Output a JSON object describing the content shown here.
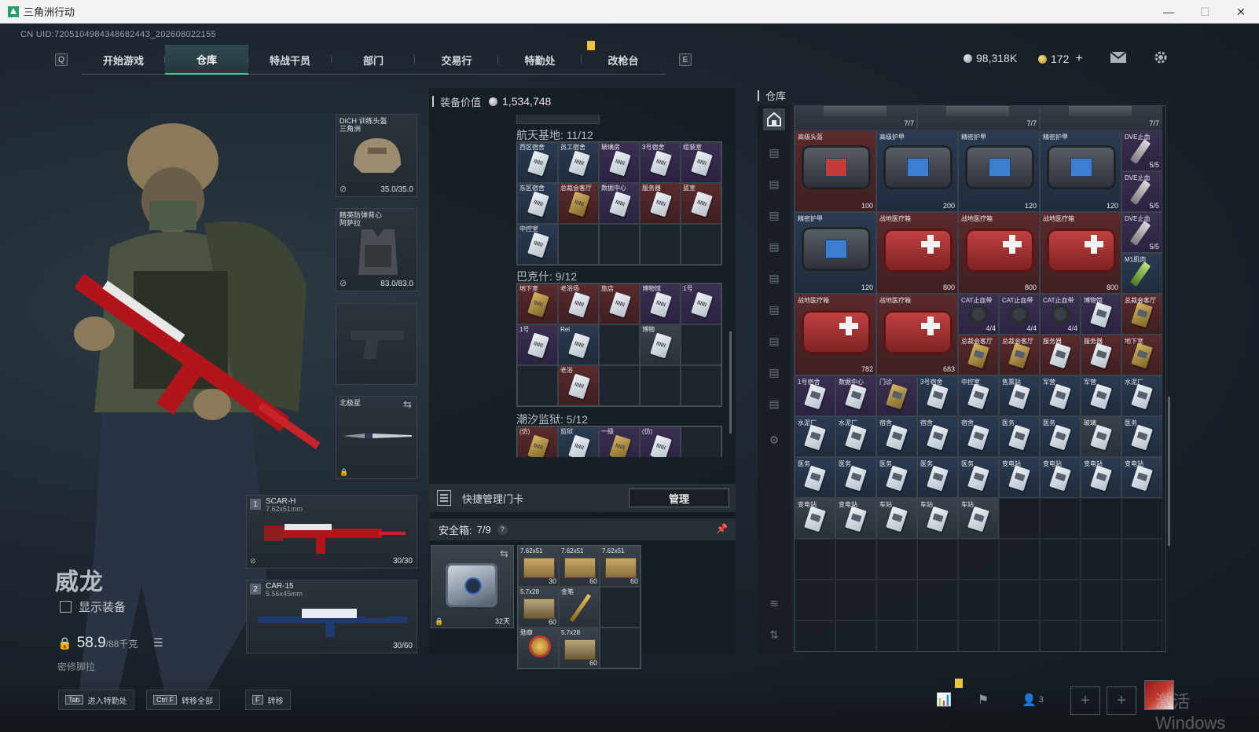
{
  "window": {
    "title": "三角洲行动",
    "minimize": "—",
    "maximize": "☐",
    "close": "✕"
  },
  "uid": "CN UID:720510498434868244З_202608022155",
  "nav": {
    "left_key": "Q",
    "right_key": "E",
    "tabs": [
      "开始游戏",
      "仓库",
      "特战干员",
      "部门",
      "交易行",
      "特勤处",
      "改枪台"
    ],
    "active_tab": "仓库"
  },
  "currency": {
    "silver": "98,318K",
    "gold": "172",
    "gold_add": "+"
  },
  "operator": {
    "name": "威龙",
    "show_gear_label": "显示装备",
    "weight_value": "58.9",
    "weight_max": "/88千克",
    "map": "密修脚拉"
  },
  "gear": {
    "helmet": {
      "label": "DICH 训练头盔\n三角洲",
      "durability": "35.0/35.0"
    },
    "armor": {
      "label": "精英防弹背心\n阿萨拉",
      "durability": "83.0/83.0"
    },
    "melee": {
      "label": "北极星"
    },
    "primary": {
      "slot": "1",
      "name": "SCAR-H",
      "caliber": "7.62x51mm",
      "ammo": "30/30"
    },
    "secondary": {
      "slot": "2",
      "name": "CAR-15",
      "caliber": "5.56x45mm",
      "ammo": "30/60"
    }
  },
  "mid": {
    "equip_value_label": "装备价值",
    "equip_value": "1,534,748",
    "sections": [
      {
        "title": "航天基地: 11/12",
        "cells": [
          {
            "label": "西区宿舍",
            "color": "blue",
            "card": "silver"
          },
          {
            "label": "员工宿舍",
            "color": "blue",
            "card": "silver"
          },
          {
            "label": "玻璃房",
            "color": "purple",
            "card": "silver"
          },
          {
            "label": "3号宿舍",
            "color": "purple",
            "card": "silver"
          },
          {
            "label": "组装室",
            "color": "purple",
            "card": "silver"
          },
          {
            "label": "东区宿舍",
            "color": "blue",
            "card": "silver"
          },
          {
            "label": "总裁会客厅",
            "color": "red",
            "card": "gold"
          },
          {
            "label": "数据中心",
            "color": "purple",
            "card": "silver"
          },
          {
            "label": "服务器",
            "color": "red",
            "card": "silver"
          },
          {
            "label": "蓝室",
            "color": "red",
            "card": "silver"
          },
          {
            "label": "中控室",
            "color": "blue",
            "card": "silver"
          }
        ]
      },
      {
        "title": "巴克什: 9/12",
        "cells": [
          {
            "label": "地下室",
            "color": "red",
            "card": "gold"
          },
          {
            "label": "老浴场",
            "color": "red",
            "card": "silver"
          },
          {
            "label": "旅店",
            "color": "red",
            "card": "silver"
          },
          {
            "label": "博物馆",
            "color": "purple",
            "card": "silver"
          },
          {
            "label": "1号",
            "color": "purple",
            "card": "silver"
          },
          {
            "label": "1号",
            "color": "purple",
            "card": "silver"
          },
          {
            "label": "Rel",
            "color": "blue",
            "card": "silver"
          },
          {
            "label": "",
            "color": "empty",
            "card": ""
          },
          {
            "label": "博物",
            "color": "gray",
            "card": "silver"
          },
          {
            "label": "",
            "color": "empty",
            "card": ""
          },
          {
            "label": "",
            "color": "empty",
            "card": ""
          },
          {
            "label": "老浴",
            "color": "red",
            "card": "silver"
          }
        ]
      },
      {
        "title": "潮汐监狱: 5/12",
        "cells": [
          {
            "label": "(仿)",
            "color": "red",
            "card": "gold"
          },
          {
            "label": "监狱",
            "color": "blue",
            "card": "silver"
          },
          {
            "label": "一级",
            "color": "purple",
            "card": "gold"
          },
          {
            "label": "(仿)",
            "color": "purple",
            "card": "silver"
          }
        ]
      }
    ],
    "quick_card_label": "快捷管理门卡",
    "manage_button": "管理",
    "safebox_label": "安全箱:",
    "safebox_count": "7/9",
    "safebox_help": "?",
    "safebox_days": "32天",
    "safebox_items": [
      {
        "label": "7.62x51",
        "qty": "30",
        "kind": "ammo"
      },
      {
        "label": "7.62x51",
        "qty": "60",
        "kind": "ammo"
      },
      {
        "label": "7.62x51",
        "qty": "60",
        "kind": "ammo"
      },
      {
        "label": "5.7x28",
        "qty": "60",
        "kind": "ammo2"
      },
      {
        "label": "金笔",
        "qty": "",
        "kind": "pen"
      },
      {
        "label": "",
        "qty": "",
        "kind": "empty"
      },
      {
        "label": "勋章",
        "qty": "",
        "kind": "medal"
      },
      {
        "label": "5.7x28",
        "qty": "60",
        "kind": "ammo2"
      },
      {
        "label": "",
        "qty": "",
        "kind": "empty"
      }
    ]
  },
  "warehouse": {
    "title": "仓库",
    "top_counts": [
      "7/7",
      "7/7",
      "7/7"
    ],
    "big_items": [
      {
        "label": "高级头盔",
        "qty": "100",
        "kind": "bag-red"
      },
      {
        "label": "高级护甲",
        "qty": "200",
        "kind": "bag-blue"
      },
      {
        "label": "精密护甲",
        "qty": "120",
        "kind": "bag-blue"
      },
      {
        "label": "精密护甲",
        "qty": "120",
        "kind": "bag-blue"
      },
      {
        "label": "精密护甲",
        "qty": "120",
        "kind": "bag-blue"
      },
      {
        "label": "战地医疗箱",
        "qty": "800",
        "kind": "medkit"
      },
      {
        "label": "战地医疗箱",
        "qty": "800",
        "kind": "medkit"
      },
      {
        "label": "战地医疗箱",
        "qty": "800",
        "kind": "medkit"
      },
      {
        "label": "战地医疗箱",
        "qty": "782",
        "kind": "medkit"
      },
      {
        "label": "战地医疗箱",
        "qty": "683",
        "kind": "medkit"
      }
    ],
    "dve_items": [
      {
        "label": "DVE止血",
        "qty": "5/5"
      },
      {
        "label": "DVE止血",
        "qty": "5/5"
      },
      {
        "label": "DVE止血",
        "qty": "5/5"
      },
      {
        "label": "M1肌肉",
        "qty": ""
      }
    ],
    "cat_items": [
      {
        "label": "CAT止血带",
        "qty": "4/4"
      },
      {
        "label": "CAT止血带",
        "qty": "4/4"
      },
      {
        "label": "CAT止血带",
        "qty": "4/4"
      }
    ],
    "small_cards": [
      {
        "label": "博物馆",
        "color": "purple",
        "card": "silver"
      },
      {
        "label": "总裁会客厅",
        "color": "red",
        "card": "gold"
      },
      {
        "label": "总裁会客厅",
        "color": "red",
        "card": "gold"
      },
      {
        "label": "总裁会客厅",
        "color": "red",
        "card": "gold"
      },
      {
        "label": "服务器",
        "color": "red",
        "card": "silver"
      },
      {
        "label": "服务器",
        "color": "red",
        "card": "silver"
      },
      {
        "label": "地下室",
        "color": "red",
        "card": "gold"
      },
      {
        "label": "1号宿舍",
        "color": "purple",
        "card": "silver"
      },
      {
        "label": "数据中心",
        "color": "purple",
        "card": "silver"
      },
      {
        "label": "门诊",
        "color": "purple",
        "card": "gold"
      },
      {
        "label": "3号宿舍",
        "color": "blue",
        "card": "silver"
      },
      {
        "label": "中控室",
        "color": "blue",
        "card": "silver"
      },
      {
        "label": "售票站",
        "color": "blue",
        "card": "silver"
      },
      {
        "label": "军营",
        "color": "blue",
        "card": "silver"
      },
      {
        "label": "军营",
        "color": "blue",
        "card": "silver"
      },
      {
        "label": "水泥厂",
        "color": "blue",
        "card": "silver"
      },
      {
        "label": "水泥厂",
        "color": "blue",
        "card": "silver"
      },
      {
        "label": "水泥厂",
        "color": "blue",
        "card": "silver"
      },
      {
        "label": "宿舍",
        "color": "blue",
        "card": "silver"
      },
      {
        "label": "宿舍",
        "color": "blue",
        "card": "silver"
      },
      {
        "label": "宿舍",
        "color": "blue",
        "card": "silver"
      },
      {
        "label": "医务",
        "color": "blue",
        "card": "silver"
      },
      {
        "label": "医务",
        "color": "blue",
        "card": "silver"
      },
      {
        "label": "玻璃",
        "color": "gray",
        "card": "silver"
      },
      {
        "label": "医务",
        "color": "blue",
        "card": "silver"
      },
      {
        "label": "医务",
        "color": "blue",
        "card": "silver"
      },
      {
        "label": "医务",
        "color": "blue",
        "card": "silver"
      },
      {
        "label": "医务",
        "color": "blue",
        "card": "silver"
      },
      {
        "label": "医务",
        "color": "blue",
        "card": "silver"
      },
      {
        "label": "医务",
        "color": "blue",
        "card": "silver"
      },
      {
        "label": "变电站",
        "color": "blue",
        "card": "silver"
      },
      {
        "label": "变电站",
        "color": "blue",
        "card": "silver"
      },
      {
        "label": "变电站",
        "color": "blue",
        "card": "silver"
      },
      {
        "label": "变电站",
        "color": "blue",
        "card": "silver"
      },
      {
        "label": "变电站",
        "color": "gray",
        "card": "silver"
      },
      {
        "label": "变电站",
        "color": "gray",
        "card": "silver"
      },
      {
        "label": "车站",
        "color": "gray",
        "card": "silver"
      },
      {
        "label": "车站",
        "color": "gray",
        "card": "silver"
      },
      {
        "label": "车站",
        "color": "gray",
        "card": "silver"
      }
    ]
  },
  "bottom": {
    "hints": [
      {
        "key": "Tab",
        "label": "进入特勤处"
      },
      {
        "key": "Ctrl F",
        "label": "转移全部"
      },
      {
        "key": "F",
        "label": "转移"
      }
    ],
    "squad_count": "3",
    "watermark": "激活 Windows"
  }
}
